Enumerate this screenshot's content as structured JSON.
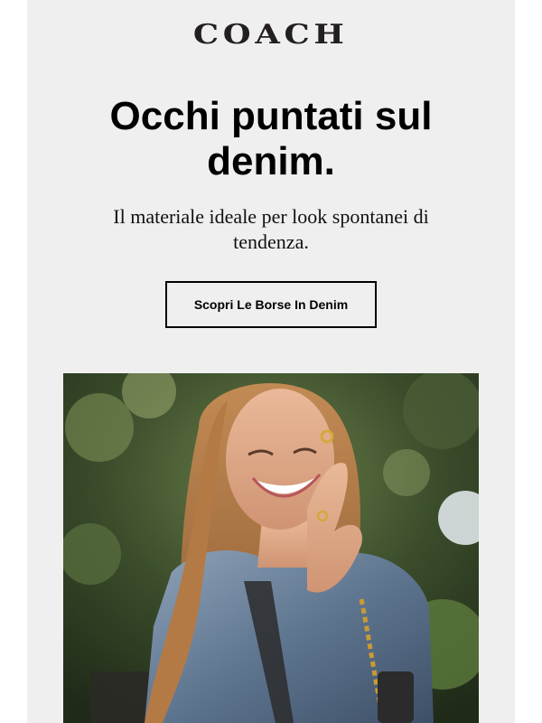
{
  "brand": {
    "logo_text": "COACH"
  },
  "hero": {
    "headline": "Occhi puntati sul denim.",
    "subheadline": "Il materiale ideale per look spontanei di tendenza.",
    "cta_label": "Scopri Le Borse In Denim"
  },
  "colors": {
    "email_background": "#efefef",
    "text": "#000000",
    "cta_border": "#000000",
    "logo": "#231f20"
  }
}
